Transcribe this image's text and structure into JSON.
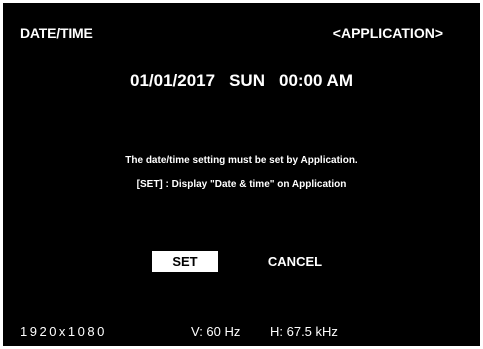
{
  "header": {
    "title": "DATE/TIME",
    "mode": "<APPLICATION>"
  },
  "datetime": {
    "date": "01/01/2017",
    "weekday": "SUN",
    "time": "00:00 AM"
  },
  "message": {
    "line1": "The date/time setting must be set by Application.",
    "line2": "[SET] : Display \"Date & time\" on Application"
  },
  "buttons": {
    "set_label": "SET",
    "cancel_label": "CANCEL"
  },
  "status": {
    "resolution": "1920x1080",
    "vertical_freq": "V: 60 Hz",
    "horizontal_freq": "H: 67.5 kHz"
  },
  "colors": {
    "background": "#000000",
    "text": "#ffffff",
    "selected_button_bg": "#ffffff",
    "selected_button_text": "#000000"
  }
}
